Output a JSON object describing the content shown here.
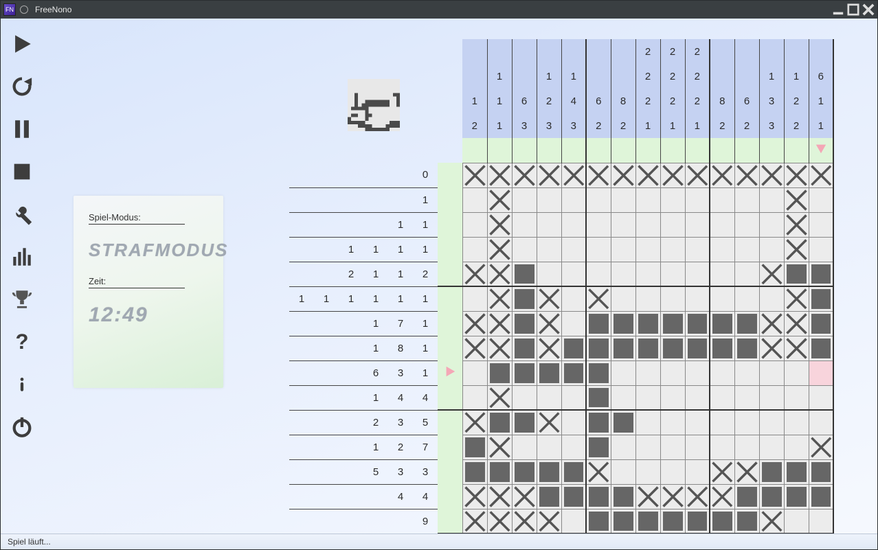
{
  "window": {
    "title": "FreeNono"
  },
  "toolbar": {
    "play": "play-icon",
    "restart": "restart-icon",
    "pause": "pause-icon",
    "stop": "stop-icon",
    "tools": "tools-icon",
    "stats": "stats-icon",
    "trophy": "trophy-icon",
    "help": "help-icon",
    "info": "info-icon",
    "power": "power-icon"
  },
  "info": {
    "mode_label": "Spiel-Modus:",
    "mode_value": "STRAFMODUS",
    "time_label": "Zeit:",
    "time_value": "12:49"
  },
  "status": {
    "text": "Spiel läuft..."
  },
  "board": {
    "cols": 15,
    "rows": 15,
    "col_clues": [
      [
        1,
        2
      ],
      [
        1,
        1,
        1
      ],
      [
        6,
        3
      ],
      [
        1,
        2,
        3
      ],
      [
        1,
        4,
        3
      ],
      [
        6,
        2
      ],
      [
        8,
        2
      ],
      [
        2,
        2,
        2,
        1
      ],
      [
        2,
        2,
        2,
        1
      ],
      [
        2,
        2,
        2,
        1
      ],
      [
        8,
        2
      ],
      [
        6,
        2
      ],
      [
        1,
        3,
        3
      ],
      [
        1,
        2,
        2
      ],
      [
        6,
        1,
        1
      ]
    ],
    "row_clues": [
      [
        0
      ],
      [
        1
      ],
      [
        1,
        1
      ],
      [
        1,
        1,
        1,
        1
      ],
      [
        2,
        1,
        1,
        2
      ],
      [
        1,
        1,
        1,
        1,
        1,
        1
      ],
      [
        1,
        7,
        1
      ],
      [
        1,
        8,
        1
      ],
      [
        6,
        3,
        1
      ],
      [
        1,
        4,
        4
      ],
      [
        2,
        3,
        5
      ],
      [
        1,
        2,
        7
      ],
      [
        5,
        3,
        3
      ],
      [
        4,
        4
      ],
      [
        9
      ]
    ],
    "marker_col": 14,
    "marker_row": 8,
    "cells": [
      [
        "x",
        "x",
        "x",
        "x",
        "x",
        "x",
        "x",
        "x",
        "x",
        "x",
        "x",
        "x",
        "x",
        "x",
        "x"
      ],
      [
        "",
        "x",
        "",
        "",
        "",
        "",
        "",
        "",
        "",
        "",
        "",
        "",
        "",
        "x",
        ""
      ],
      [
        "",
        "x",
        "",
        "",
        "",
        "",
        "",
        "",
        "",
        "",
        "",
        "",
        "",
        "x",
        ""
      ],
      [
        "",
        "x",
        "",
        "",
        "",
        "",
        "",
        "",
        "",
        "",
        "",
        "",
        "",
        "x",
        ""
      ],
      [
        "x",
        "x",
        "b",
        "",
        "",
        "",
        "",
        "",
        "",
        "",
        "",
        "",
        "x",
        "b",
        "b"
      ],
      [
        "",
        "x",
        "b",
        "x",
        "",
        "x",
        "",
        "",
        "",
        "",
        "",
        "",
        "",
        "x",
        "b"
      ],
      [
        "x",
        "x",
        "b",
        "x",
        "",
        "b",
        "b",
        "b",
        "b",
        "b",
        "b",
        "b",
        "x",
        "x",
        "b"
      ],
      [
        "x",
        "x",
        "b",
        "x",
        "b",
        "b",
        "b",
        "b",
        "b",
        "b",
        "b",
        "b",
        "x",
        "x",
        "b"
      ],
      [
        "",
        "b",
        "b",
        "b",
        "b",
        "b",
        "",
        "",
        "",
        "",
        "",
        "",
        "",
        "",
        "sel"
      ],
      [
        "",
        "x",
        "",
        "",
        "",
        "b",
        "",
        "",
        "",
        "",
        "",
        "",
        "",
        "",
        ""
      ],
      [
        "x",
        "b",
        "b",
        "x",
        "",
        "b",
        "b",
        "",
        "",
        "",
        "",
        "",
        "",
        "",
        ""
      ],
      [
        "b",
        "x",
        "",
        "",
        "",
        "b",
        "",
        "",
        "",
        "",
        "",
        "",
        "",
        "",
        "x"
      ],
      [
        "b",
        "b",
        "b",
        "b",
        "b",
        "x",
        "",
        "",
        "",
        "",
        "x",
        "x",
        "b",
        "b",
        "b"
      ],
      [
        "x",
        "x",
        "x",
        "b",
        "b",
        "b",
        "b",
        "x",
        "x",
        "x",
        "x",
        "b",
        "b",
        "b",
        "b"
      ],
      [
        "x",
        "x",
        "x",
        "x",
        "",
        "b",
        "b",
        "b",
        "b",
        "b",
        "b",
        "b",
        "x",
        "",
        ""
      ]
    ]
  }
}
